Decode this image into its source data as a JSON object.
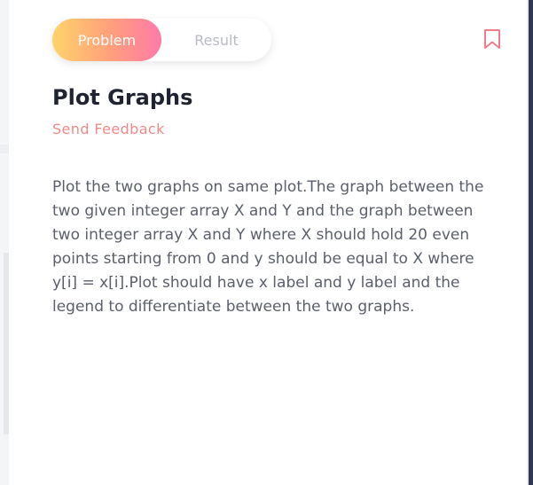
{
  "tabs": {
    "problem_label": "Problem",
    "result_label": "Result"
  },
  "icons": {
    "bookmark": "bookmark-icon"
  },
  "colors": {
    "accent_gradient": [
      "#ffd36a",
      "#ff9e7d",
      "#ff7aa8"
    ],
    "feedback": "#f08a8a",
    "bookmark": "#f07e8a",
    "title": "#1f2430",
    "body_text": "#5a5f6b"
  },
  "problem": {
    "title": "Plot Graphs",
    "feedback_label": "Send Feedback",
    "description": "Plot the two graphs on same plot.The graph between the two given integer array X and Y and the graph between two integer array X and Y where X should hold 20 even points starting from 0 and y should be equal to X where y[i] = x[i].Plot should have x label and y label and the legend to differentiate between the two graphs."
  }
}
